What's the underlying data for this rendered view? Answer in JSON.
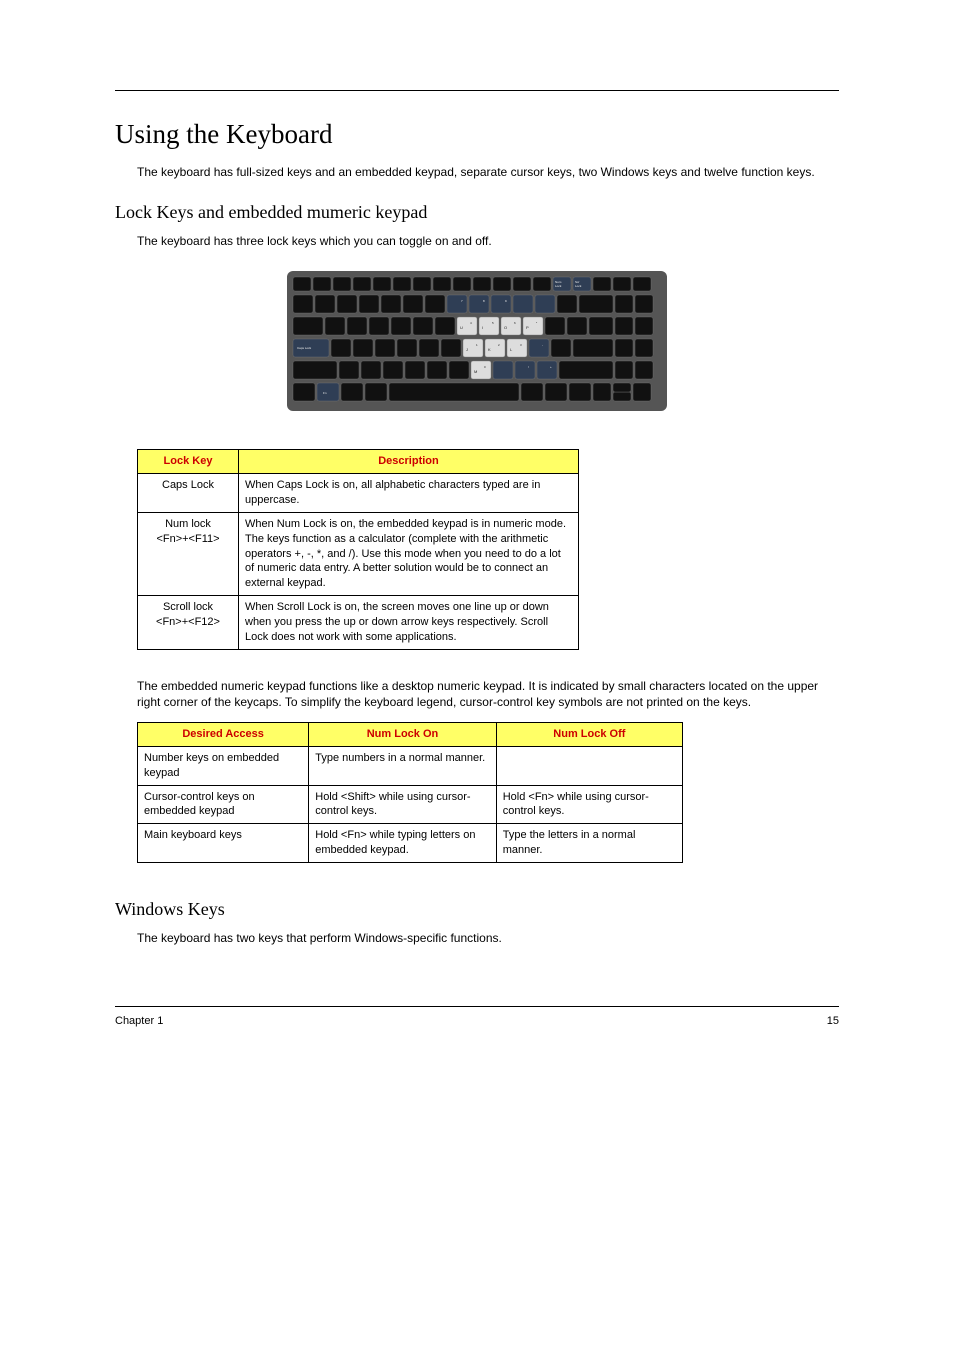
{
  "title": "Using the Keyboard",
  "intro": "The keyboard has full-sized keys and an embedded keypad, separate cursor keys, two Windows keys and twelve function keys.",
  "section_lock": {
    "heading": "Lock Keys and embedded mumeric keypad",
    "lead": "The keyboard has three lock keys which you can toggle on and off.",
    "table": {
      "headers": [
        "Lock Key",
        "Description"
      ],
      "rows": [
        {
          "key": "Caps Lock",
          "desc": "When Caps Lock is on, all alphabetic characters typed are in uppercase."
        },
        {
          "key": "Num lock\n<Fn>+<F11>",
          "desc": "When Num Lock is on, the embedded keypad is in numeric mode. The keys function as a calculator (complete with the arithmetic operators +, -, *, and /). Use this mode when you need to do a lot of numeric data entry. A better solution would be to connect an external keypad."
        },
        {
          "key": "Scroll lock\n<Fn>+<F12>",
          "desc": "When Scroll Lock is on, the screen moves one line up or down when you press the up or down arrow keys respectively. Scroll Lock does not work with some applications."
        }
      ]
    },
    "body_after": "The embedded numeric keypad functions like a desktop numeric keypad. It is indicated by small characters located on the upper right corner of the keycaps. To simplify the keyboard legend, cursor-control key symbols are not printed on the keys.",
    "access_table": {
      "headers": [
        "Desired Access",
        "Num Lock On",
        "Num Lock Off"
      ],
      "rows": [
        {
          "c0": "Number keys on embedded keypad",
          "c1": "Type numbers in a normal manner.",
          "c2": ""
        },
        {
          "c0": "Cursor-control keys on embedded keypad",
          "c1": "Hold <Shift> while using cursor-control keys.",
          "c2": "Hold <Fn> while using cursor-control keys."
        },
        {
          "c0": "Main keyboard keys",
          "c1": "Hold <Fn> while typing letters on embedded keypad.",
          "c2": "Type the letters in a normal manner."
        }
      ]
    }
  },
  "section_win": {
    "heading": "Windows Keys",
    "lead": "The keyboard has two keys that perform Windows-specific functions."
  },
  "footer": {
    "left": "Chapter 1",
    "right": "15"
  },
  "kbd_labels": {
    "caps": "Caps Lock",
    "fn": "Fn",
    "numlk_t": "Num",
    "numlk_b": "Lock",
    "scrlk_t": "Scr",
    "scrlk_b": "Lock",
    "u": "U",
    "u4": "4",
    "i": "I",
    "i5": "5",
    "o": "O",
    "o6": "6",
    "p": "P",
    "px": "*",
    "j": "J",
    "j1": "1",
    "k": "K",
    "k2": "2",
    "l": "L",
    "l3": "3",
    "m": "M",
    "m0": "0",
    "n7": "7",
    "n8": "8",
    "n9": "9",
    "plus": "+",
    "minus": "-",
    "slash": "/",
    "n8s": "*",
    "n9s": "9",
    "np": "8"
  }
}
